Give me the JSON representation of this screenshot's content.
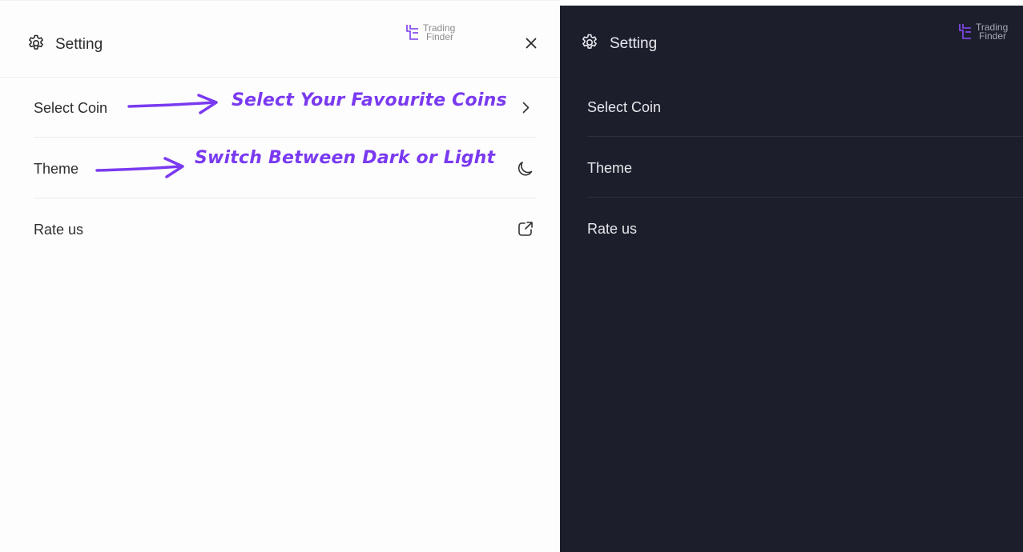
{
  "colors": {
    "accent": "#7a3af0",
    "dark_bg": "#1c1f2b",
    "light_bg": "#fdfdfd"
  },
  "light_panel": {
    "header": {
      "icon": "gear-icon",
      "title": "Setting",
      "logo_line1": "Trading",
      "logo_line2": "Finder",
      "close_icon": "close-icon"
    },
    "menu": [
      {
        "label": "Select Coin",
        "icon": "chevron-right-icon"
      },
      {
        "label": "Theme",
        "icon": "moon-icon"
      },
      {
        "label": "Rate us",
        "icon": "external-link-icon"
      }
    ],
    "annotations": [
      "Select Your Favourite Coins",
      "Switch Between Dark or Light"
    ]
  },
  "dark_panel": {
    "header": {
      "icon": "gear-icon",
      "title": "Setting",
      "logo_line1": "Trading",
      "logo_line2": "Finder"
    },
    "menu": [
      {
        "label": "Select Coin"
      },
      {
        "label": "Theme"
      },
      {
        "label": "Rate us"
      }
    ]
  }
}
